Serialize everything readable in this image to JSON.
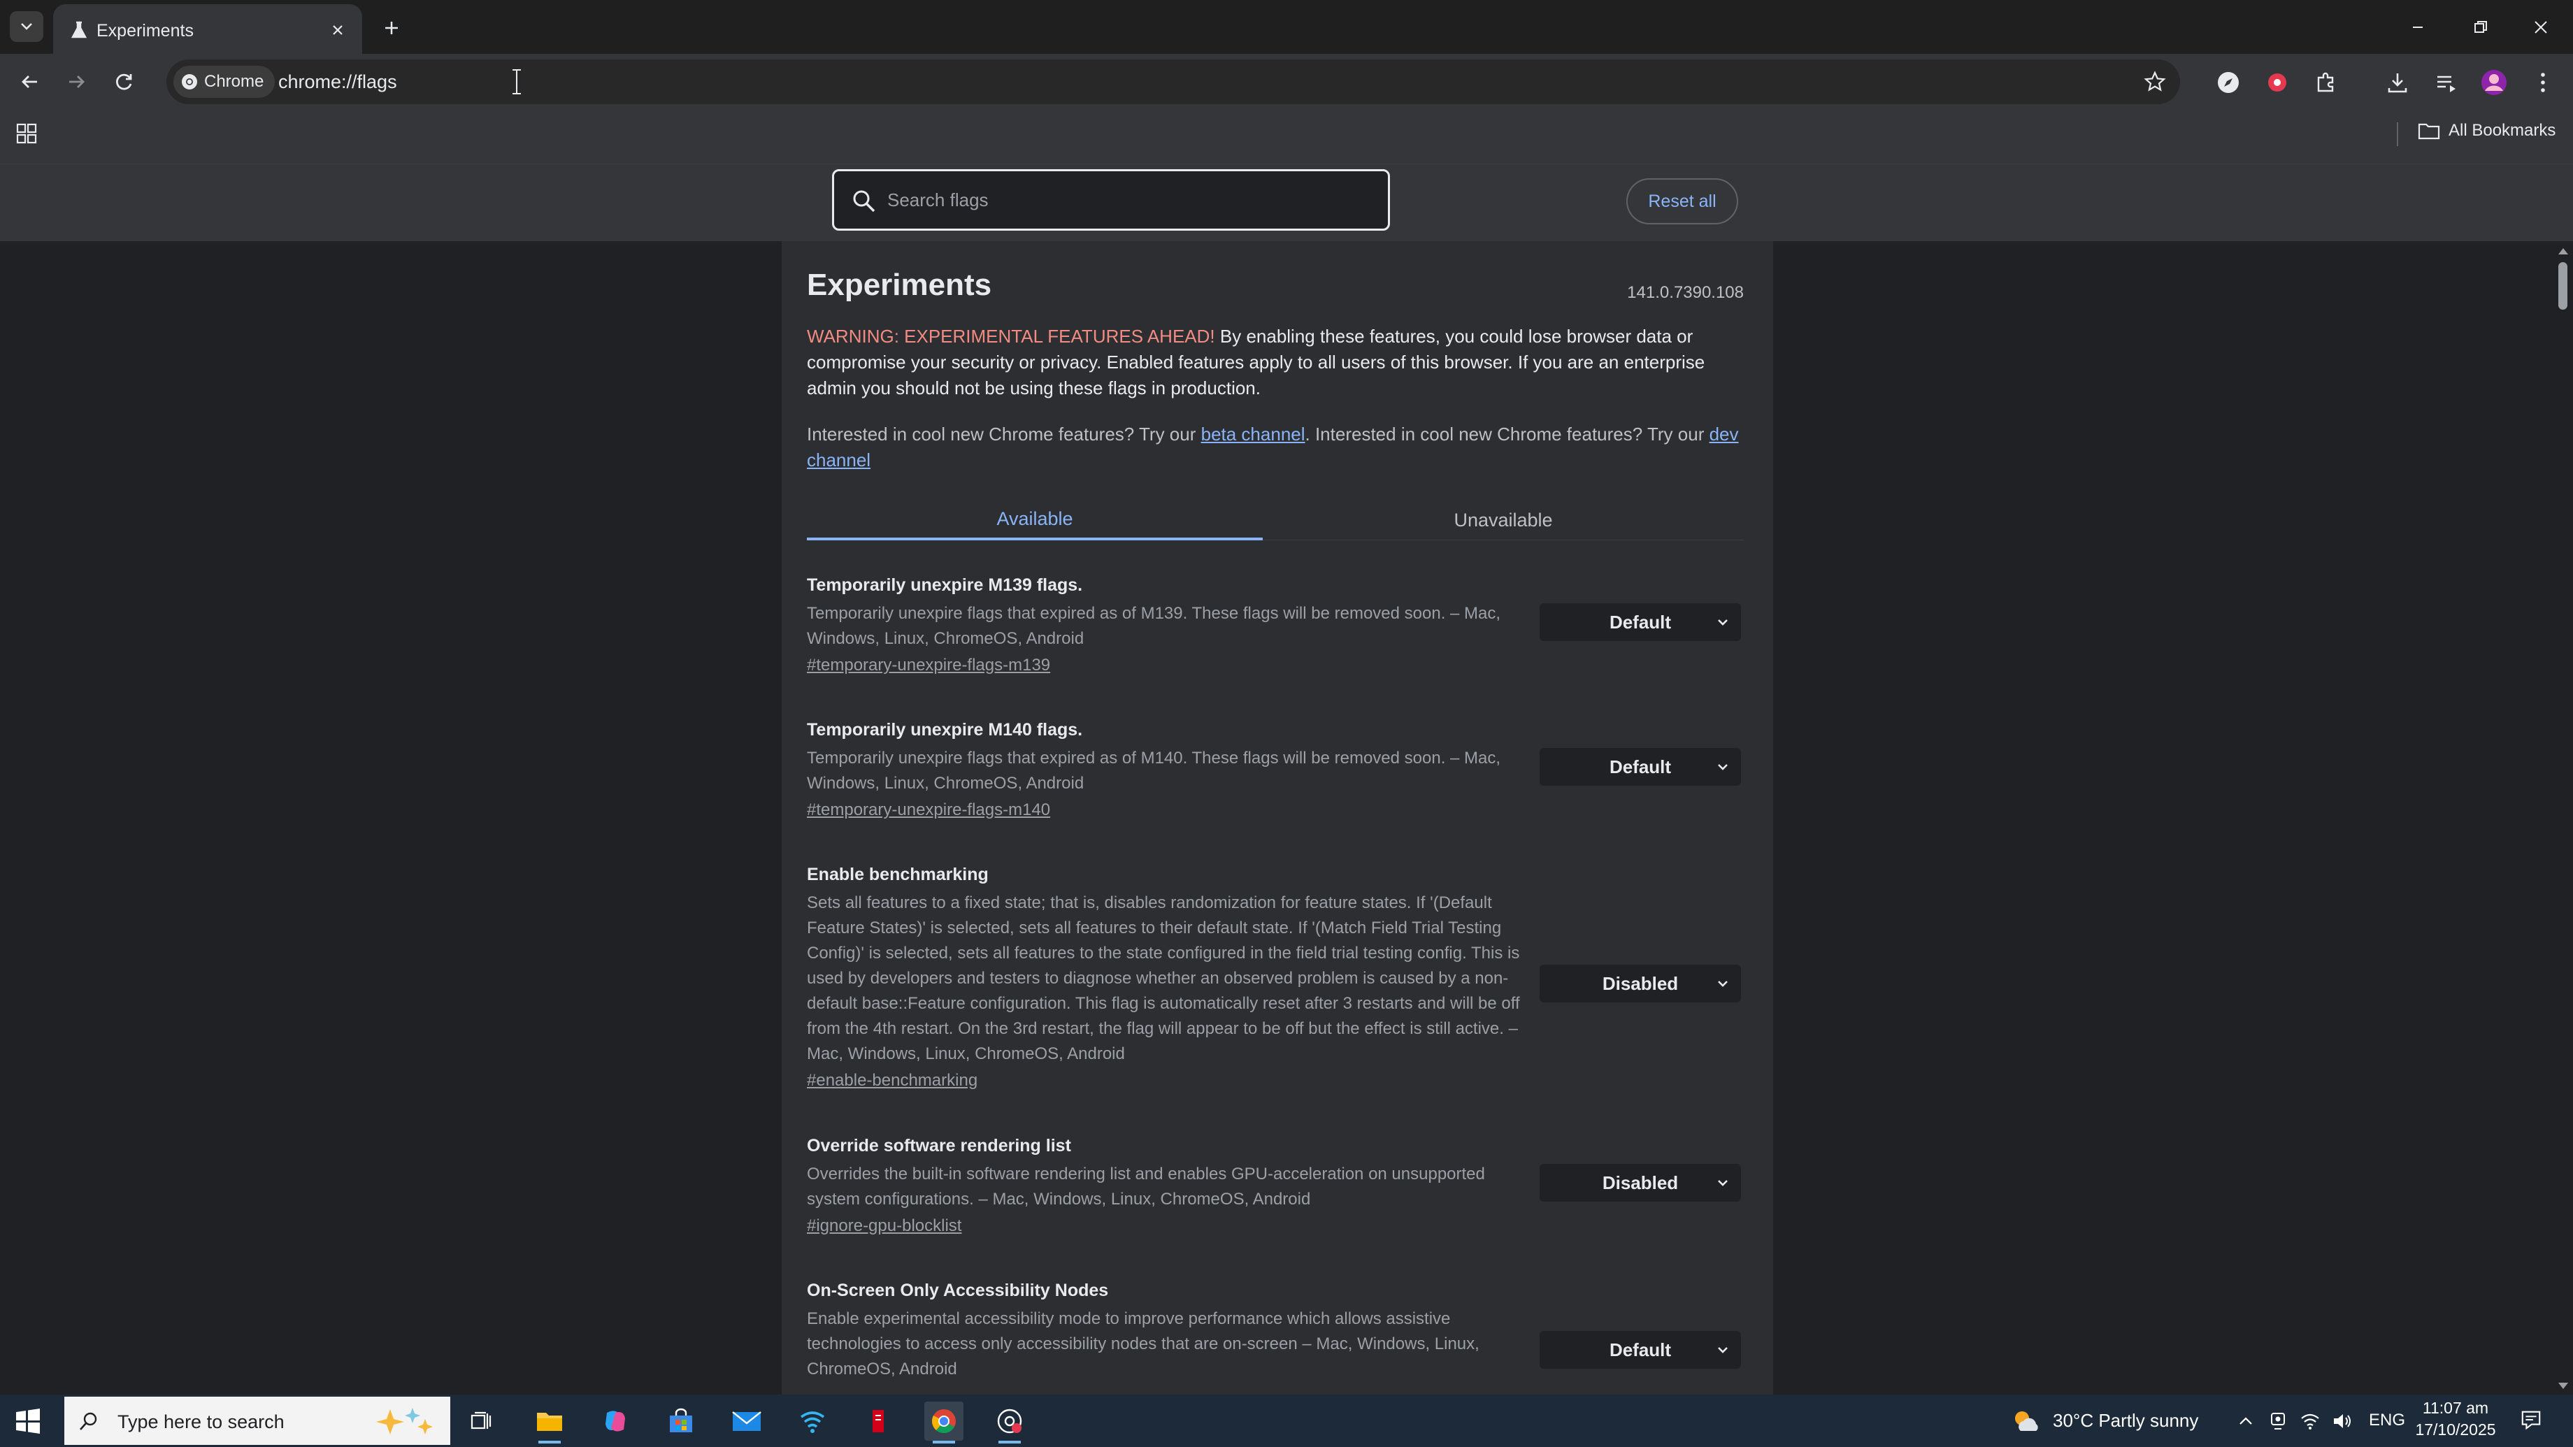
{
  "browser": {
    "tab_title": "Experiments",
    "site_chip": "Chrome",
    "url": "chrome://flags",
    "all_bookmarks": "All Bookmarks"
  },
  "flags_header": {
    "search_placeholder": "Search flags",
    "reset_label": "Reset all"
  },
  "page": {
    "title": "Experiments",
    "version": "141.0.7390.108",
    "warning_label": "WARNING: EXPERIMENTAL FEATURES AHEAD!",
    "warning_text": " By enabling these features, you could lose browser data or compromise your security or privacy. Enabled features apply to all users of this browser. If you are an enterprise admin you should not be using these flags in production.",
    "promo_prefix": "Interested in cool new Chrome features? Try our ",
    "beta_link": "beta channel",
    "promo_middle": ". Interested in cool new Chrome features? Try our ",
    "dev_link": "dev channel",
    "tab_available": "Available",
    "tab_unavailable": "Unavailable"
  },
  "flags": [
    {
      "name": "Temporarily unexpire M139 flags.",
      "description": "Temporarily unexpire flags that expired as of M139. These flags will be removed soon. – Mac, Windows, Linux, ChromeOS, Android",
      "link": "#temporary-unexpire-flags-m139",
      "value": "Default"
    },
    {
      "name": "Temporarily unexpire M140 flags.",
      "description": "Temporarily unexpire flags that expired as of M140. These flags will be removed soon. – Mac, Windows, Linux, ChromeOS, Android",
      "link": "#temporary-unexpire-flags-m140",
      "value": "Default"
    },
    {
      "name": "Enable benchmarking",
      "description": "Sets all features to a fixed state; that is, disables randomization for feature states. If '(Default Feature States)' is selected, sets all features to their default state. If '(Match Field Trial Testing Config)' is selected, sets all features to the state configured in the field trial testing config. This is used by developers and testers to diagnose whether an observed problem is caused by a non-default base::Feature configuration. This flag is automatically reset after 3 restarts and will be off from the 4th restart. On the 3rd restart, the flag will appear to be off but the effect is still active. – Mac, Windows, Linux, ChromeOS, Android",
      "link": "#enable-benchmarking",
      "value": "Disabled"
    },
    {
      "name": "Override software rendering list",
      "description": "Overrides the built-in software rendering list and enables GPU-acceleration on unsupported system configurations. – Mac, Windows, Linux, ChromeOS, Android",
      "link": "#ignore-gpu-blocklist",
      "value": "Disabled"
    },
    {
      "name": "On-Screen Only Accessibility Nodes",
      "description": "Enable experimental accessibility mode to improve performance which allows assistive technologies to access only accessibility nodes that are on-screen – Mac, Windows, Linux, ChromeOS, Android",
      "link": "",
      "value": "Default"
    }
  ],
  "taskbar": {
    "search_placeholder": "Type here to search",
    "weather": "30°C  Partly sunny",
    "language": "ENG",
    "time": "11:07 am",
    "date": "17/10/2025"
  }
}
